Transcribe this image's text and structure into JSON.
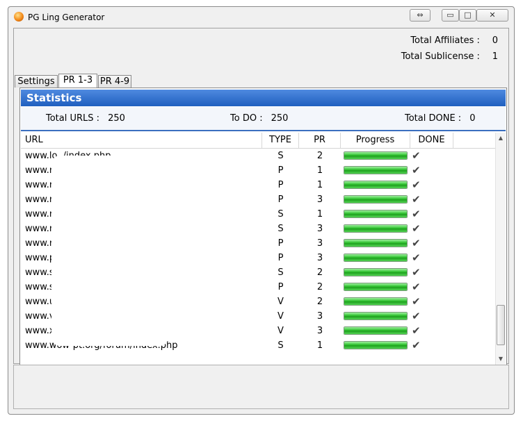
{
  "window": {
    "title": "PG Ling Generator",
    "controls": {
      "resize": "⇔",
      "minimize": "▭",
      "maximize": "□",
      "close": "✕"
    }
  },
  "totals": {
    "affiliates_label": "Total Affiliates :",
    "affiliates_value": "0",
    "sublicense_label": "Total Sublicense :",
    "sublicense_value": "1"
  },
  "tabs": [
    {
      "label": "Settings",
      "active": false
    },
    {
      "label": "PR 1-3",
      "active": true
    },
    {
      "label": "PR 4-9",
      "active": false
    }
  ],
  "statistics": {
    "title": "Statistics",
    "total_urls_label": "Total URLS :",
    "total_urls_value": "250",
    "todo_label": "To DO :",
    "todo_value": "250",
    "total_done_label": "Total DONE :",
    "total_done_value": "0"
  },
  "table": {
    "columns": [
      "URL",
      "TYPE",
      "PR",
      "Progress",
      "DONE"
    ],
    "rows": [
      {
        "url": "www.lo                          ./index.php",
        "type": "S",
        "pr": "2",
        "progress": 1.0,
        "done": "✔"
      },
      {
        "url": "www.r                           index.php",
        "type": "P",
        "pr": "1",
        "progress": 1.0,
        "done": "✔"
      },
      {
        "url": "www.r                           n/index.php",
        "type": "P",
        "pr": "1",
        "progress": 1.0,
        "done": "✔"
      },
      {
        "url": "www.r                           /index.php",
        "type": "P",
        "pr": "3",
        "progress": 1.0,
        "done": "✔"
      },
      {
        "url": "www.r",
        "type": "S",
        "pr": "1",
        "progress": 1.0,
        "done": "✔"
      },
      {
        "url": "www.r                           ndex.php",
        "type": "S",
        "pr": "3",
        "progress": 1.0,
        "done": "✔"
      },
      {
        "url": "www.r                           um/protez-usb-belle",
        "type": "P",
        "pr": "3",
        "progress": 1.0,
        "done": "✔"
      },
      {
        "url": "www.p",
        "type": "P",
        "pr": "3",
        "progress": 1.0,
        "done": "✔"
      },
      {
        "url": "www.s",
        "type": "S",
        "pr": "2",
        "progress": 1.0,
        "done": "✔"
      },
      {
        "url": "www.s",
        "type": "P",
        "pr": "2",
        "progress": 1.0,
        "done": "✔"
      },
      {
        "url": "www.u",
        "type": "V",
        "pr": "2",
        "progress": 1.0,
        "done": "✔"
      },
      {
        "url": "www.v                           dex.php",
        "type": "V",
        "pr": "3",
        "progress": 1.0,
        "done": "✔"
      },
      {
        "url": "www.x                           p",
        "type": "V",
        "pr": "3",
        "progress": 1.0,
        "done": "✔"
      },
      {
        "url": "www.wow-pt.org/forum/index.php",
        "type": "S",
        "pr": "1",
        "progress": 1.0,
        "done": "✔"
      }
    ]
  },
  "scrollbar": {
    "up": "▲",
    "down": "▼"
  },
  "colors": {
    "header_blue": "#1f5fbf",
    "progress_green": "#2ec22e"
  }
}
